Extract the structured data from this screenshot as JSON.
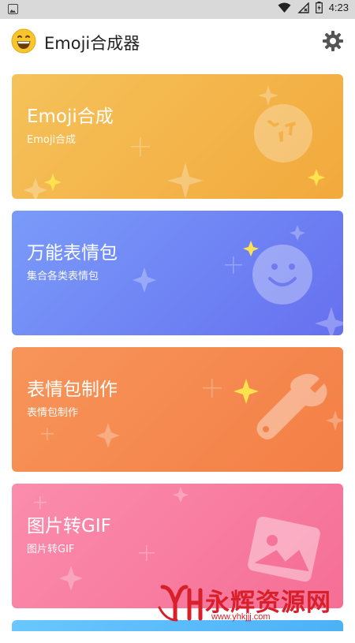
{
  "status_bar": {
    "time": "4:23",
    "icons": [
      "image-notification-icon",
      "wifi-icon",
      "no-signal-icon",
      "battery-charging-icon"
    ]
  },
  "toolbar": {
    "title": "Emoji合成器",
    "logo_icon": "grinning-emoji-icon",
    "settings_icon": "gear-icon"
  },
  "cards": [
    {
      "title": "Emoji合成",
      "subtitle": "Emoji合成",
      "icon": "squint-face-icon",
      "color": "#f2a93c"
    },
    {
      "title": "万能表情包",
      "subtitle": "集合各类表情包",
      "icon": "smile-face-icon",
      "color": "#6670ef"
    },
    {
      "title": "表情包制作",
      "subtitle": "表情包制作",
      "icon": "wrench-icon",
      "color": "#f37f46"
    },
    {
      "title": "图片转GIF",
      "subtitle": "图片转GIF",
      "icon": "picture-icon",
      "color": "#f56e96"
    }
  ],
  "watermark": {
    "text": "永辉资源网",
    "url": "www.yhkjjj.com"
  }
}
